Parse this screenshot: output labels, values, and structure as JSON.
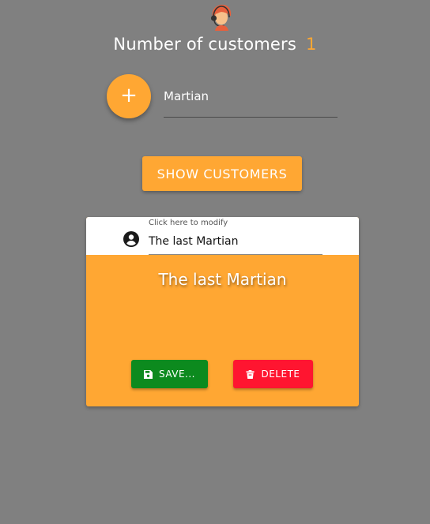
{
  "header": {
    "title": "Number of customers",
    "count": "1"
  },
  "add_form": {
    "add_icon": "plus-icon",
    "name_value": "Martian"
  },
  "show_button": {
    "label": "SHOW CUSTOMERS"
  },
  "customer_card": {
    "field_label": "Click here to modify",
    "field_value": "The last Martian",
    "name": "The last Martian",
    "save_label": "SAVE...",
    "delete_label": "DELETE"
  },
  "colors": {
    "background": "#808080",
    "accent": "#ffa733",
    "save": "#0c8a1e",
    "delete": "#ff1530"
  },
  "icons": [
    "support-agent-logo-icon",
    "plus-icon",
    "account-circle-icon",
    "save-icon",
    "delete-icon"
  ]
}
